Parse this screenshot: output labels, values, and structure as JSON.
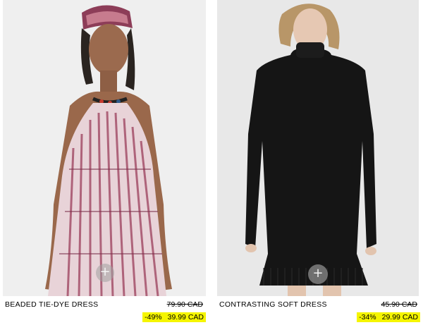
{
  "products": [
    {
      "name": "BEADED TIE-DYE DRESS",
      "old_price": "79.90 CAD",
      "discount": "-49%",
      "price": "39.99 CAD",
      "add_icon": "+"
    },
    {
      "name": "CONTRASTING SOFT DRESS",
      "old_price": "45.90 CAD",
      "discount": "-34%",
      "price": "29.99 CAD",
      "add_icon": "+"
    }
  ],
  "colors": {
    "sale_highlight": "#f5f500",
    "dress_left": "#a4506a",
    "dress_right": "#151515"
  }
}
